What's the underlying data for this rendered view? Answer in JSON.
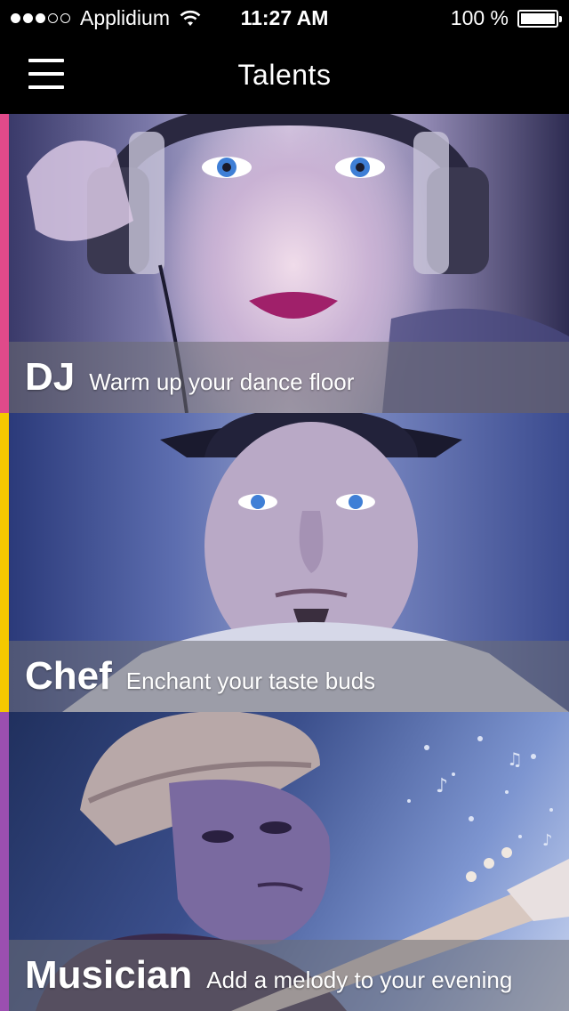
{
  "status_bar": {
    "carrier": "Applidium",
    "time": "11:27 AM",
    "battery": "100 %",
    "signal_bars_filled": 3,
    "signal_bars_total": 5,
    "battery_level": 1.0
  },
  "nav": {
    "title": "Talents",
    "menu_icon": "hamburger-menu-icon"
  },
  "talents": [
    {
      "title": "DJ",
      "tagline": "Warm up your dance floor",
      "accent": "#e04a8a"
    },
    {
      "title": "Chef",
      "tagline": "Enchant your taste buds",
      "accent": "#f5c800"
    },
    {
      "title": "Musician",
      "tagline": "Add a melody to your evening",
      "accent": "#9b4fb0"
    }
  ]
}
